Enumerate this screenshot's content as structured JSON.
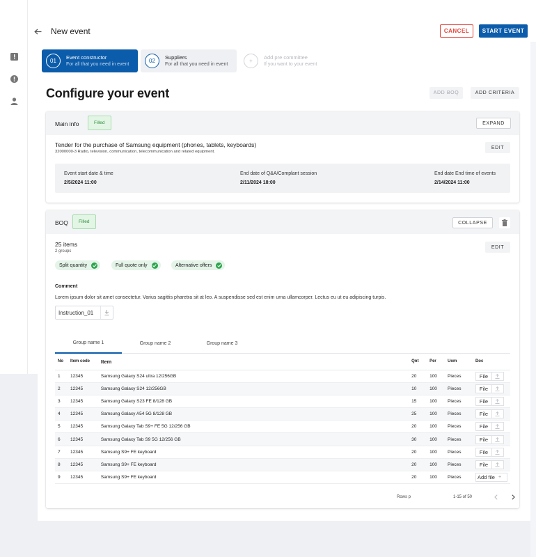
{
  "header": {
    "title": "New event",
    "cancel_label": "CANCEL",
    "start_label": "START EVENT"
  },
  "stepper": [
    {
      "num": "01",
      "title": "Event constructor",
      "subtitle": "For all that you need in event"
    },
    {
      "num": "02",
      "title": "Suppliers",
      "subtitle": "For all that you need in event"
    },
    {
      "num": "+",
      "title": "Add pre committee",
      "subtitle": "If you want to your event"
    }
  ],
  "configure": {
    "title": "Configure your event",
    "add_boq_label": "ADD BOQ",
    "add_criteria_label": "ADD CRITERIA"
  },
  "main_info": {
    "title": "Main info",
    "badge": "Filled",
    "expand_label": "EXPAND",
    "edit_label": "EDIT",
    "tender_title": "Tender for the purchase of Samsung equipment (phones, tablets, keyboards)",
    "tender_sub": "32000000-3 Radio, television, communication, telecommunication and related equipment.",
    "dates": [
      {
        "label": "Event start date & time",
        "value": "2/5/2024 11:00"
      },
      {
        "label": "End date of Q&A/Complant session",
        "value": "2/11/2024 18:00"
      },
      {
        "label": "End date End time of events",
        "value": "2/14/2024 11:00"
      }
    ]
  },
  "boq": {
    "title": "BOQ",
    "badge": "Filled",
    "collapse_label": "COLLAPSE",
    "edit_label": "EDIT",
    "items_count": "25 items",
    "groups_count": "2 groups",
    "chips": [
      "Split quantity",
      "Full quote only",
      "Alternative offers"
    ],
    "comment_label": "Comment",
    "comment_text": "Lorem ipsum dolor sit amet consectetur. Varius sagittis pharetra sit at leo. A suspendisse sed est enim urna ullamcorper. Lectus eu ut eu adipiscing turpis.",
    "attachment": "Instruction_01",
    "tabs": [
      "Group name 1",
      "Group name 2",
      "Group name 3"
    ],
    "columns": {
      "no": "No",
      "code": "Item code",
      "item": "Item",
      "qnt": "Qnt",
      "per": "Per",
      "uom": "Uom",
      "doc": "Doc"
    },
    "rows": [
      {
        "no": "1",
        "code": "12345",
        "item": "Samsung Galaxy S24 ultra 12/256GB",
        "qnt": "20",
        "per": "100",
        "uom": "Pieces",
        "doc": "File"
      },
      {
        "no": "2",
        "code": "12345",
        "item": "Samsung Galaxy S24 12/256GB",
        "qnt": "10",
        "per": "100",
        "uom": "Pieces",
        "doc": "File"
      },
      {
        "no": "3",
        "code": "12345",
        "item": "Samsung Galaxy S23 FE 8/128 GB",
        "qnt": "15",
        "per": "100",
        "uom": "Pieces",
        "doc": "File"
      },
      {
        "no": "4",
        "code": "12345",
        "item": "Samsung Galaxy A54 5G 8/128 GB",
        "qnt": "25",
        "per": "100",
        "uom": "Pieces",
        "doc": "File"
      },
      {
        "no": "5",
        "code": "12345",
        "item": "Samsung Galaxy  Tab S9+ FE 5G 12/256 GB",
        "qnt": "20",
        "per": "100",
        "uom": "Pieces",
        "doc": "File"
      },
      {
        "no": "6",
        "code": "12345",
        "item": "Samsung Galaxy Tab S9 5G 12/256 GB",
        "qnt": "30",
        "per": "100",
        "uom": "Pieces",
        "doc": "File"
      },
      {
        "no": "7",
        "code": "12345",
        "item": "Samsung S9+ FE keyboard",
        "qnt": "20",
        "per": "100",
        "uom": "Pieces",
        "doc": "File"
      },
      {
        "no": "8",
        "code": "12345",
        "item": "Samsung S9+ FE keyboard",
        "qnt": "20",
        "per": "100",
        "uom": "Pieces",
        "doc": "File"
      },
      {
        "no": "9",
        "code": "12345",
        "item": "Samsung S9+ FE keyboard",
        "qnt": "20",
        "per": "100",
        "uom": "Pieces",
        "doc": "Add file"
      }
    ],
    "pager": {
      "rows_label": "Rows p",
      "range": "1-15 of 50"
    }
  },
  "colors": {
    "accent": "#0b5cab",
    "danger": "#e2453a",
    "success": "#2ea44f"
  }
}
